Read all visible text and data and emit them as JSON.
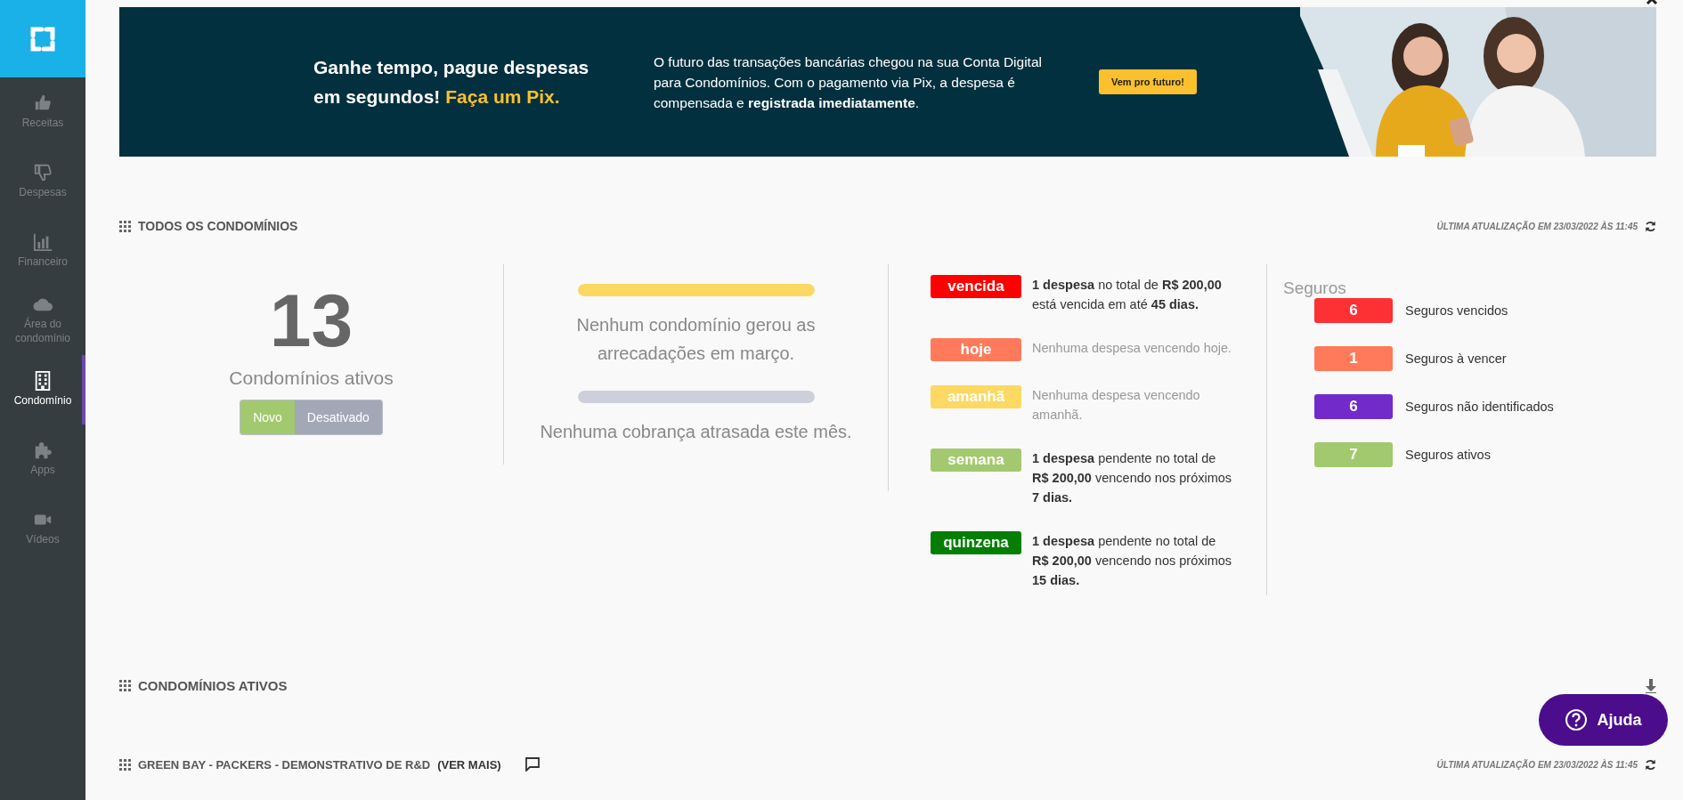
{
  "sidebar": {
    "items": [
      {
        "kind": "thumbs-up",
        "label": "Receitas",
        "selected": false
      },
      {
        "kind": "thumbs-down",
        "label": "Despesas",
        "selected": false
      },
      {
        "kind": "chart",
        "label": "Financeiro",
        "selected": false
      },
      {
        "kind": "cloud",
        "label": "Área do condomínio",
        "selected": false
      },
      {
        "kind": "building",
        "label": "Condomínio",
        "selected": true
      },
      {
        "kind": "puzzle",
        "label": "Apps",
        "selected": false
      },
      {
        "kind": "video",
        "label": "Vídeos",
        "selected": false
      }
    ]
  },
  "banner": {
    "headline": "Ganhe tempo, pague despesas em segundos!",
    "headline_highlight": "Faça um Pix.",
    "body": "O futuro das transações bancárias chegou na sua Conta Digital para Condomínios. Com o pagamento via Pix, a despesa é compensada e **registrada imediatamente**.",
    "button": "Vem pro futuro!"
  },
  "summary": {
    "title": "TODOS OS CONDOMÍNIOS",
    "updated": "ÚLTIMA ATUALIZAÇÃO EM 23/03/2022 ÀS 11:45",
    "active_count": "13",
    "active_label": "Condomínios ativos",
    "toggle": [
      {
        "label": "Novo",
        "selected": true
      },
      {
        "label": "Desativado",
        "selected": false
      }
    ],
    "progress": [
      {
        "level": 1,
        "color": "#fcd862",
        "text": "Nenhum condomínio gerou as arrecadações em março."
      },
      {
        "level": 1,
        "color": "#cdd0da",
        "text": "Nenhuma cobrança atrasada este mês."
      }
    ],
    "due": [
      {
        "tag": "vencida",
        "color": "#fe0000",
        "muted": false,
        "text": "**1 despesa** no total de **R$ 200,00** está vencida em até **45 dias.**"
      },
      {
        "tag": "hoje",
        "color": "#fe7a5b",
        "muted": true,
        "text": "Nenhuma despesa vencendo hoje."
      },
      {
        "tag": "amanhã",
        "color": "#fdd862",
        "muted": true,
        "text": "Nenhuma despesa vencendo amanhã."
      },
      {
        "tag": "semana",
        "color": "#a2c96d",
        "muted": false,
        "text": "**1 despesa** pendente no total de **R$ 200,00** vencendo nos próximos **7 dias.**"
      },
      {
        "tag": "quinzena",
        "color": "#047f04",
        "muted": false,
        "text": "**1 despesa** pendente no total de **R$ 200,00** vencendo nos próximos **15 dias.**"
      }
    ],
    "insurance": {
      "title": "Seguros",
      "items": [
        {
          "count": "6",
          "color": "#fd3034",
          "label": "Seguros vencidos"
        },
        {
          "count": "1",
          "color": "#fe7a5b",
          "label": "Seguros à vencer"
        },
        {
          "count": "6",
          "color": "#722bca",
          "label": "Seguros não identificados"
        },
        {
          "count": "7",
          "color": "#a2c96d",
          "label": "Seguros ativos"
        }
      ]
    }
  },
  "active_section": {
    "title": "CONDOMÍNIOS ATIVOS"
  },
  "group": {
    "title": "GREEN BAY - PACKERS - DEMONSTRATIVO DE R&D",
    "link": "(VER MAIS)",
    "updated": "ÚLTIMA ATUALIZAÇÃO EM 23/03/2022 ÀS 11:45"
  },
  "help": {
    "label": "Ajuda"
  }
}
